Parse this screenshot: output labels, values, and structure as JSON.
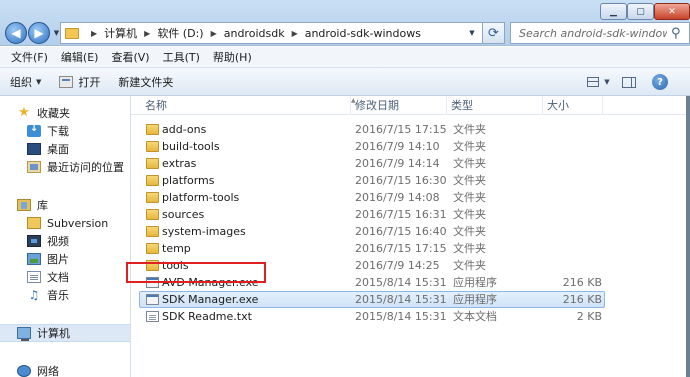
{
  "address_bar": {
    "crumbs": [
      "计算机",
      "软件 (D:)",
      "androidsdk",
      "android-sdk-windows"
    ]
  },
  "search": {
    "placeholder": "Search android-sdk-windows"
  },
  "menu": [
    "文件(F)",
    "编辑(E)",
    "查看(V)",
    "工具(T)",
    "帮助(H)"
  ],
  "commands": {
    "organize": "组织",
    "open": "打开",
    "new_folder": "新建文件夹"
  },
  "navigation": {
    "favorites": {
      "label": "收藏夹",
      "items": [
        "下载",
        "桌面",
        "最近访问的位置"
      ]
    },
    "libraries": {
      "label": "库",
      "items": [
        "Subversion",
        "视频",
        "图片",
        "文档",
        "音乐"
      ]
    },
    "computer": {
      "label": "计算机"
    },
    "network": {
      "label": "网络"
    }
  },
  "columns": {
    "name": "名称",
    "date": "修改日期",
    "type": "类型",
    "size": "大小"
  },
  "files": [
    {
      "name": "add-ons",
      "date": "2016/7/15 17:15",
      "type": "文件夹",
      "size": "",
      "kind": "folder"
    },
    {
      "name": "build-tools",
      "date": "2016/7/9 14:10",
      "type": "文件夹",
      "size": "",
      "kind": "folder"
    },
    {
      "name": "extras",
      "date": "2016/7/9 14:14",
      "type": "文件夹",
      "size": "",
      "kind": "folder"
    },
    {
      "name": "platforms",
      "date": "2016/7/15 16:30",
      "type": "文件夹",
      "size": "",
      "kind": "folder"
    },
    {
      "name": "platform-tools",
      "date": "2016/7/9 14:08",
      "type": "文件夹",
      "size": "",
      "kind": "folder"
    },
    {
      "name": "sources",
      "date": "2016/7/15 16:31",
      "type": "文件夹",
      "size": "",
      "kind": "folder"
    },
    {
      "name": "system-images",
      "date": "2016/7/15 16:40",
      "type": "文件夹",
      "size": "",
      "kind": "folder"
    },
    {
      "name": "temp",
      "date": "2016/7/15 17:15",
      "type": "文件夹",
      "size": "",
      "kind": "folder"
    },
    {
      "name": "tools",
      "date": "2016/7/9 14:25",
      "type": "文件夹",
      "size": "",
      "kind": "folder"
    },
    {
      "name": "AVD Manager.exe",
      "date": "2015/8/14 15:31",
      "type": "应用程序",
      "size": "216 KB",
      "kind": "exe"
    },
    {
      "name": "SDK Manager.exe",
      "date": "2015/8/14 15:31",
      "type": "应用程序",
      "size": "216 KB",
      "kind": "exe",
      "selected": true
    },
    {
      "name": "SDK Readme.txt",
      "date": "2015/8/14 15:31",
      "type": "文本文档",
      "size": "2 KB",
      "kind": "txt"
    }
  ],
  "colors": {
    "highlight_box": "#e02020",
    "selection": "#cfe3f8",
    "folder": "#e6b73d"
  }
}
